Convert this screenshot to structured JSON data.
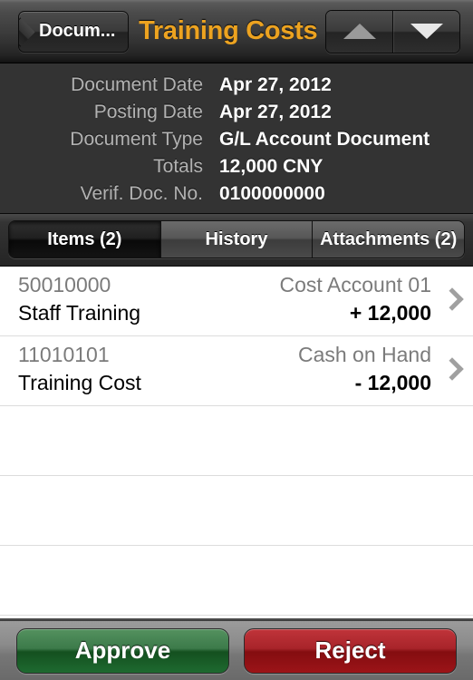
{
  "navbar": {
    "back_label": "Docum...",
    "title": "Training Costs",
    "up_icon": "triangle-up-icon",
    "down_icon": "triangle-down-icon",
    "title_color": "#eda320"
  },
  "detail": {
    "rows": [
      {
        "label": "Document Date",
        "value": "Apr 27, 2012"
      },
      {
        "label": "Posting Date",
        "value": "Apr 27, 2012"
      },
      {
        "label": "Document Type",
        "value": "G/L Account Document"
      },
      {
        "label": "Totals",
        "value": "12,000 CNY"
      },
      {
        "label": "Verif. Doc. No.",
        "value": "0100000000"
      }
    ]
  },
  "tabs": [
    {
      "label": "Items (2)",
      "selected": true
    },
    {
      "label": "History",
      "selected": false
    },
    {
      "label": "Attachments (2)",
      "selected": false
    }
  ],
  "items": [
    {
      "account": "50010000",
      "description": "Staff Training",
      "category": "Cost Account 01",
      "amount": "+ 12,000",
      "chevron": "chevron-right-icon"
    },
    {
      "account": "11010101",
      "description": "Training Cost",
      "category": "Cash on Hand",
      "amount": "- 12,000",
      "chevron": "chevron-right-icon"
    }
  ],
  "empty_rows": 3,
  "toolbar": {
    "approve_label": "Approve",
    "reject_label": "Reject",
    "approve_color": "#1e6a30",
    "reject_color": "#9c1418"
  }
}
